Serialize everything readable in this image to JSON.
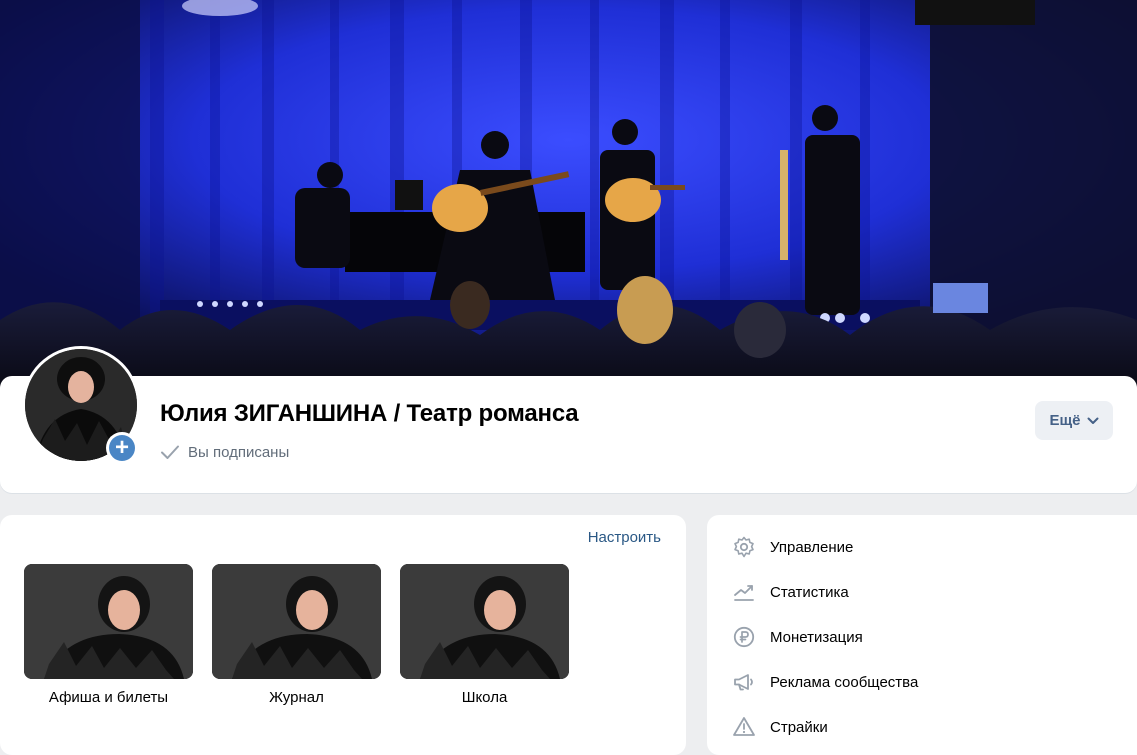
{
  "community": {
    "name": "Юлия ЗИГАНШИНА / Театр романса",
    "subscribed_label": "Вы подписаны",
    "more_label": "Ещё"
  },
  "icons": {
    "add": "plus-icon",
    "subscribed": "check-icon",
    "more": "chevron-down-icon"
  },
  "apps": {
    "configure_label": "Настроить",
    "items": [
      {
        "label": "Афиша и билеты"
      },
      {
        "label": "Журнал"
      },
      {
        "label": "Школа"
      }
    ]
  },
  "menu": {
    "items": [
      {
        "label": "Управление",
        "icon": "gear-icon"
      },
      {
        "label": "Статистика",
        "icon": "chart-icon"
      },
      {
        "label": "Монетизация",
        "icon": "ruble-icon"
      },
      {
        "label": "Реклама сообщества",
        "icon": "megaphone-icon"
      },
      {
        "label": "Страйки",
        "icon": "warning-icon"
      }
    ]
  },
  "colors": {
    "accent": "#4a86c5",
    "link": "#2a5885",
    "stage_blue": "#1f2fd6"
  }
}
